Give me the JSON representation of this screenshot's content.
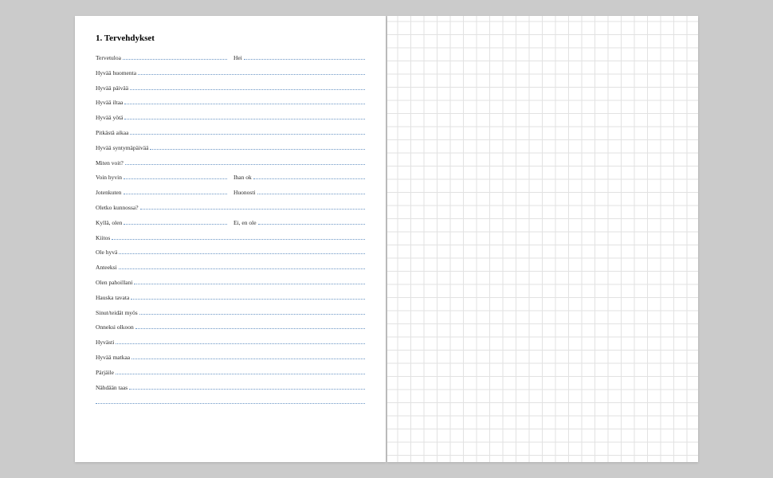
{
  "heading": "1. Tervehdykset",
  "rows": [
    {
      "cells": [
        "Tervetuloa",
        "Hei"
      ]
    },
    {
      "cells": [
        "Hyvää huomenta"
      ]
    },
    {
      "cells": [
        "Hyvää päivää"
      ]
    },
    {
      "cells": [
        "Hyvää iltaa"
      ]
    },
    {
      "cells": [
        "Hyvää yötä"
      ]
    },
    {
      "cells": [
        "Pitkästä aikaa"
      ]
    },
    {
      "cells": [
        "Hyvää syntymäpäivää"
      ]
    },
    {
      "cells": [
        "Miten voit?"
      ]
    },
    {
      "cells": [
        "Voin hyvin",
        "Ihan ok"
      ]
    },
    {
      "cells": [
        "Jotenkuten",
        "Huonosti"
      ]
    },
    {
      "cells": [
        "Oletko kunnossa?"
      ]
    },
    {
      "cells": [
        "Kyllä, olen",
        "Ei, en ole"
      ]
    },
    {
      "cells": [
        "Kiitos"
      ]
    },
    {
      "cells": [
        "Ole hyvä"
      ]
    },
    {
      "cells": [
        "Anteeksi"
      ]
    },
    {
      "cells": [
        "Olen pahoillani"
      ]
    },
    {
      "cells": [
        "Hauska tavata"
      ]
    },
    {
      "cells": [
        "Sinut/teidät myös"
      ]
    },
    {
      "cells": [
        "Onneksi olkoon"
      ]
    },
    {
      "cells": [
        "Hyvästi"
      ]
    },
    {
      "cells": [
        "Hyvää matkaa"
      ]
    },
    {
      "cells": [
        "Pärjäile"
      ]
    },
    {
      "cells": [
        "Nähdään taas"
      ]
    },
    {
      "cells": [
        ""
      ]
    }
  ],
  "colors": {
    "dotted_line": "#6a95c4",
    "grid_line": "#e2e2e2",
    "background": "#cbcbcb",
    "page": "#ffffff"
  }
}
